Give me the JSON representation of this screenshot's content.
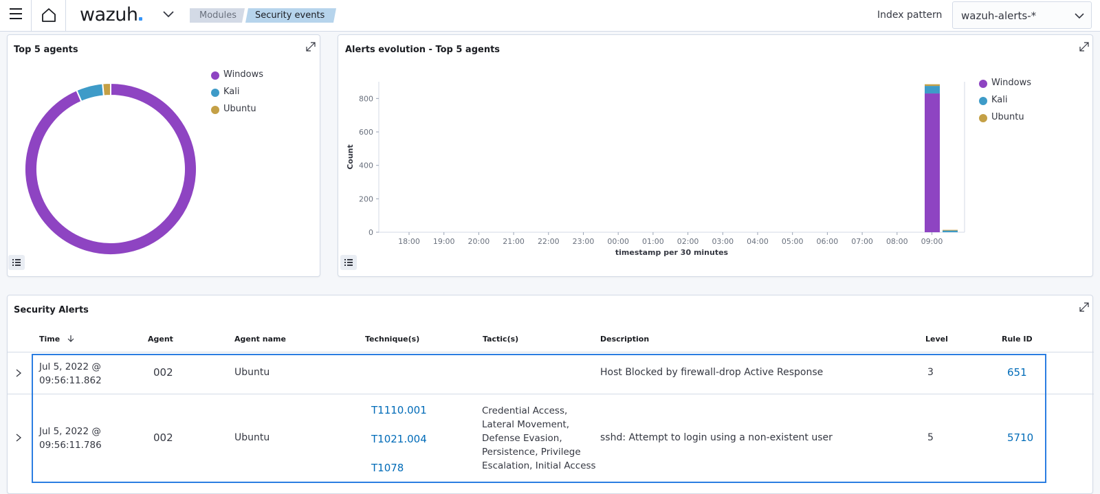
{
  "header": {
    "logo": "wazuh",
    "breadcrumb": [
      "Modules",
      "Security events"
    ],
    "index_pattern_label": "Index pattern",
    "index_pattern_value": "wazuh-alerts-*"
  },
  "top_agents": {
    "title": "Top 5 agents",
    "legend": [
      "Windows",
      "Kali",
      "Ubuntu"
    ],
    "colors": {
      "Windows": "#8e44c2",
      "Kali": "#3e9bc8",
      "Ubuntu": "#c4a046"
    }
  },
  "alerts_evolution": {
    "title": "Alerts evolution - Top 5 agents",
    "legend": [
      "Windows",
      "Kali",
      "Ubuntu"
    ]
  },
  "chart_data": [
    {
      "type": "pie",
      "title": "Top 5 agents",
      "categories": [
        "Windows",
        "Kali",
        "Ubuntu"
      ],
      "values": [
        93.5,
        5.0,
        1.5
      ]
    },
    {
      "type": "bar",
      "title": "Alerts evolution - Top 5 agents",
      "xlabel": "timestamp per 30 minutes",
      "ylabel": "Count",
      "ylim": [
        0,
        900
      ],
      "yticks": [
        0,
        200,
        400,
        600,
        800
      ],
      "x_ticks": [
        "18:00",
        "19:00",
        "20:00",
        "21:00",
        "22:00",
        "23:00",
        "00:00",
        "01:00",
        "02:00",
        "03:00",
        "04:00",
        "05:00",
        "06:00",
        "07:00",
        "08:00",
        "09:00"
      ],
      "categories": [
        "09:00",
        "09:30"
      ],
      "series": [
        {
          "name": "Windows",
          "values": [
            830,
            0
          ]
        },
        {
          "name": "Kali",
          "values": [
            45,
            10
          ]
        },
        {
          "name": "Ubuntu",
          "values": [
            10,
            4
          ]
        }
      ]
    }
  ],
  "security_alerts": {
    "title": "Security Alerts",
    "columns": [
      "Time",
      "Agent",
      "Agent name",
      "Technique(s)",
      "Tactic(s)",
      "Description",
      "Level",
      "Rule ID"
    ],
    "rows": [
      {
        "time_date": "Jul 5, 2022 @",
        "time_clock": "09:56:11.862",
        "agent": "002",
        "agent_name": "Ubuntu",
        "techniques": [],
        "tactics": [],
        "description": "Host Blocked by firewall-drop Active Response",
        "level": "3",
        "rule_id": "651"
      },
      {
        "time_date": "Jul 5, 2022 @",
        "time_clock": "09:56:11.786",
        "agent": "002",
        "agent_name": "Ubuntu",
        "techniques": [
          "T1110.001",
          "T1021.004",
          "T1078"
        ],
        "tactics": [
          "Credential Access,",
          "Lateral Movement,",
          "Defense Evasion,",
          "Persistence, Privilege",
          "Escalation, Initial Access"
        ],
        "description": "sshd: Attempt to login using a non-existent user",
        "level": "5",
        "rule_id": "5710"
      }
    ]
  }
}
